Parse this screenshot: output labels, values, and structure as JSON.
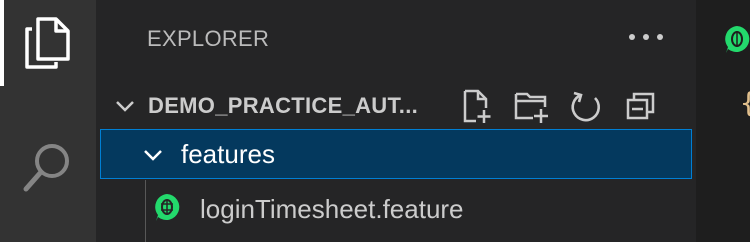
{
  "activity_bar": {
    "items": [
      {
        "icon": "files-icon",
        "active": true
      },
      {
        "icon": "search-icon",
        "active": false
      }
    ]
  },
  "sidebar": {
    "title": "EXPLORER",
    "more_actions_icon": "ellipsis-icon",
    "section": {
      "title": "DEMO_PRACTICE_AUT...",
      "actions": [
        "new-file-icon",
        "new-folder-icon",
        "refresh-icon",
        "collapse-all-icon"
      ]
    },
    "tree": {
      "folder": {
        "label": "features",
        "expanded": true
      },
      "file": {
        "label": "loginTimesheet.feature",
        "icon": "cucumber-icon"
      }
    }
  },
  "editor": {
    "tab_icon": "cucumber-icon",
    "glyph": "{"
  },
  "colors": {
    "selection_bg": "#04395e",
    "selection_border": "#007fd4",
    "cucumber_green": "#23d96c",
    "activity_bar_bg": "#333333",
    "sidebar_bg": "#252526"
  }
}
